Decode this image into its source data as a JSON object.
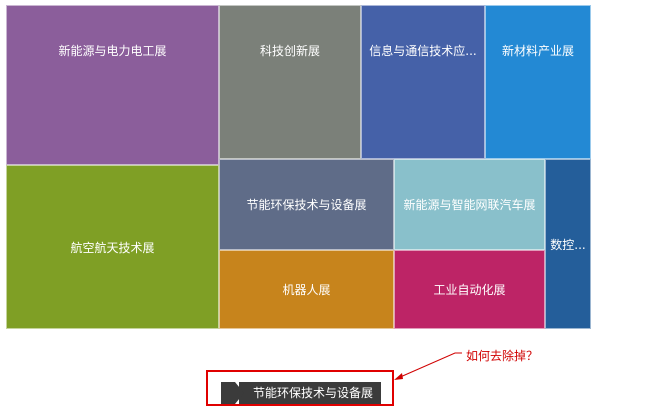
{
  "treemap": {
    "tiles": [
      {
        "label": "新能源与电力电工展",
        "color": "#8b5e9b"
      },
      {
        "label": "科技创新展",
        "color": "#7b8079"
      },
      {
        "label": "信息与通信技术应...",
        "color": "#4561a8"
      },
      {
        "label": "新材料产业展",
        "color": "#2389d4"
      },
      {
        "label": "航空航天技术展",
        "color": "#7f9f25"
      },
      {
        "label": "节能环保技术与设备展",
        "color": "#5f6c88"
      },
      {
        "label": "新能源与智能网联汽车展",
        "color": "#89c0cb"
      },
      {
        "label": "数控...",
        "color": "#245e9a"
      },
      {
        "label": "机器人展",
        "color": "#c7841c"
      },
      {
        "label": "工业自动化展",
        "color": "#bd2466"
      }
    ]
  },
  "breadcrumb": {
    "current": "节能环保技术与设备展"
  },
  "annotation": {
    "text": "如何去除掉？",
    "color": "#d00000"
  }
}
